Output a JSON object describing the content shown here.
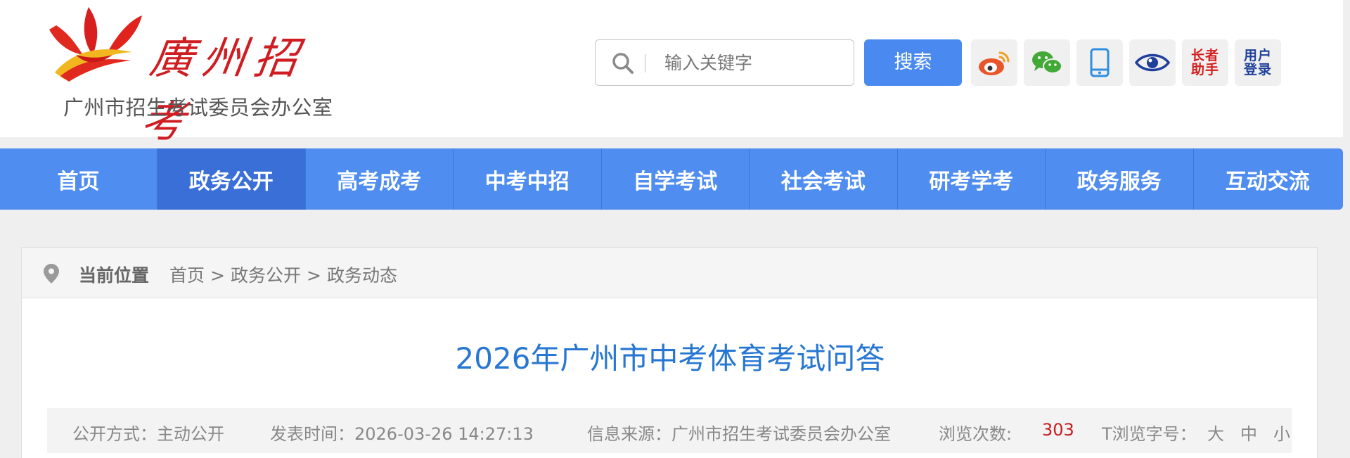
{
  "header": {
    "logo_title": "廣州招考",
    "logo_subtitle": "广州市招生考试委员会办公室",
    "search": {
      "placeholder": "输入关键字",
      "button_label": "搜索"
    },
    "icons": {
      "weibo": "weibo-icon",
      "wechat": "wechat-icon",
      "mobile": "mobile-icon",
      "accessibility": "eye-icon",
      "elder_label": "长者\n助手",
      "login_label": "用户\n登录"
    },
    "colors": {
      "brand_red": "#cf1d22",
      "nav_blue": "#4f8df0",
      "nav_active": "#3a6fd8",
      "title_blue": "#2777d2"
    }
  },
  "nav": {
    "items": [
      {
        "label": "首页"
      },
      {
        "label": "政务公开"
      },
      {
        "label": "高考成考"
      },
      {
        "label": "中考中招"
      },
      {
        "label": "自学考试"
      },
      {
        "label": "社会考试"
      },
      {
        "label": "研考学考"
      },
      {
        "label": "政务服务"
      },
      {
        "label": "互动交流"
      }
    ],
    "active_index": 1
  },
  "breadcrumb": {
    "label": "当前位置",
    "path": [
      "首页",
      ">",
      "政务公开",
      ">",
      "政务动态"
    ]
  },
  "article": {
    "title": "2026年广州市中考体育考试问答",
    "meta": {
      "disclosure": "公开方式：主动公开",
      "publish_time": "发表时间：2026-03-26 14:27:13",
      "source": "信息来源：广州市招生考试委员会办公室",
      "views_label": "浏览次数:",
      "views_value": "303",
      "font_label": "T浏览字号：",
      "font_large": "大",
      "font_medium": "中",
      "font_small": "小"
    }
  }
}
